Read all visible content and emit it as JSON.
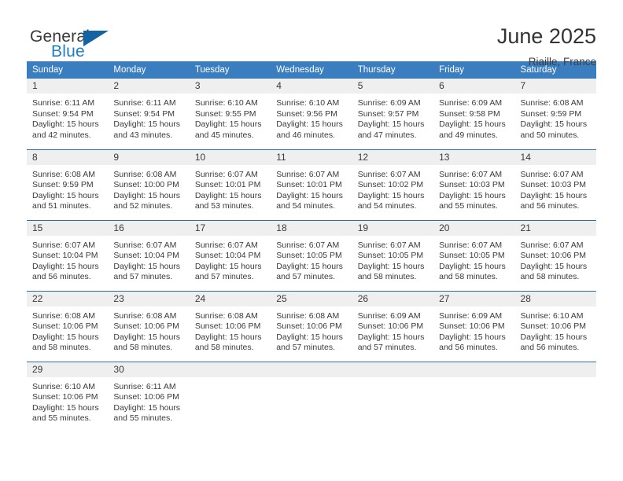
{
  "brand": {
    "word_one": "General",
    "word_two": "Blue",
    "logo_icon": "triangle-logo-icon"
  },
  "header": {
    "title": "June 2025",
    "location": "Riaille, France"
  },
  "calendar": {
    "weekday_headers": [
      "Sunday",
      "Monday",
      "Tuesday",
      "Wednesday",
      "Thursday",
      "Friday",
      "Saturday"
    ],
    "colors": {
      "header_blue": "#3a7ebf",
      "row_border_blue": "#2e6da4",
      "daynum_band": "#efefef",
      "brand_blue": "#1f7ec4",
      "logo_blue": "#1464a5"
    },
    "weeks": [
      [
        {
          "day": "1",
          "sunrise": "Sunrise: 6:11 AM",
          "sunset": "Sunset: 9:54 PM",
          "daylight_line1": "Daylight: 15 hours",
          "daylight_line2": "and 42 minutes."
        },
        {
          "day": "2",
          "sunrise": "Sunrise: 6:11 AM",
          "sunset": "Sunset: 9:54 PM",
          "daylight_line1": "Daylight: 15 hours",
          "daylight_line2": "and 43 minutes."
        },
        {
          "day": "3",
          "sunrise": "Sunrise: 6:10 AM",
          "sunset": "Sunset: 9:55 PM",
          "daylight_line1": "Daylight: 15 hours",
          "daylight_line2": "and 45 minutes."
        },
        {
          "day": "4",
          "sunrise": "Sunrise: 6:10 AM",
          "sunset": "Sunset: 9:56 PM",
          "daylight_line1": "Daylight: 15 hours",
          "daylight_line2": "and 46 minutes."
        },
        {
          "day": "5",
          "sunrise": "Sunrise: 6:09 AM",
          "sunset": "Sunset: 9:57 PM",
          "daylight_line1": "Daylight: 15 hours",
          "daylight_line2": "and 47 minutes."
        },
        {
          "day": "6",
          "sunrise": "Sunrise: 6:09 AM",
          "sunset": "Sunset: 9:58 PM",
          "daylight_line1": "Daylight: 15 hours",
          "daylight_line2": "and 49 minutes."
        },
        {
          "day": "7",
          "sunrise": "Sunrise: 6:08 AM",
          "sunset": "Sunset: 9:59 PM",
          "daylight_line1": "Daylight: 15 hours",
          "daylight_line2": "and 50 minutes."
        }
      ],
      [
        {
          "day": "8",
          "sunrise": "Sunrise: 6:08 AM",
          "sunset": "Sunset: 9:59 PM",
          "daylight_line1": "Daylight: 15 hours",
          "daylight_line2": "and 51 minutes."
        },
        {
          "day": "9",
          "sunrise": "Sunrise: 6:08 AM",
          "sunset": "Sunset: 10:00 PM",
          "daylight_line1": "Daylight: 15 hours",
          "daylight_line2": "and 52 minutes."
        },
        {
          "day": "10",
          "sunrise": "Sunrise: 6:07 AM",
          "sunset": "Sunset: 10:01 PM",
          "daylight_line1": "Daylight: 15 hours",
          "daylight_line2": "and 53 minutes."
        },
        {
          "day": "11",
          "sunrise": "Sunrise: 6:07 AM",
          "sunset": "Sunset: 10:01 PM",
          "daylight_line1": "Daylight: 15 hours",
          "daylight_line2": "and 54 minutes."
        },
        {
          "day": "12",
          "sunrise": "Sunrise: 6:07 AM",
          "sunset": "Sunset: 10:02 PM",
          "daylight_line1": "Daylight: 15 hours",
          "daylight_line2": "and 54 minutes."
        },
        {
          "day": "13",
          "sunrise": "Sunrise: 6:07 AM",
          "sunset": "Sunset: 10:03 PM",
          "daylight_line1": "Daylight: 15 hours",
          "daylight_line2": "and 55 minutes."
        },
        {
          "day": "14",
          "sunrise": "Sunrise: 6:07 AM",
          "sunset": "Sunset: 10:03 PM",
          "daylight_line1": "Daylight: 15 hours",
          "daylight_line2": "and 56 minutes."
        }
      ],
      [
        {
          "day": "15",
          "sunrise": "Sunrise: 6:07 AM",
          "sunset": "Sunset: 10:04 PM",
          "daylight_line1": "Daylight: 15 hours",
          "daylight_line2": "and 56 minutes."
        },
        {
          "day": "16",
          "sunrise": "Sunrise: 6:07 AM",
          "sunset": "Sunset: 10:04 PM",
          "daylight_line1": "Daylight: 15 hours",
          "daylight_line2": "and 57 minutes."
        },
        {
          "day": "17",
          "sunrise": "Sunrise: 6:07 AM",
          "sunset": "Sunset: 10:04 PM",
          "daylight_line1": "Daylight: 15 hours",
          "daylight_line2": "and 57 minutes."
        },
        {
          "day": "18",
          "sunrise": "Sunrise: 6:07 AM",
          "sunset": "Sunset: 10:05 PM",
          "daylight_line1": "Daylight: 15 hours",
          "daylight_line2": "and 57 minutes."
        },
        {
          "day": "19",
          "sunrise": "Sunrise: 6:07 AM",
          "sunset": "Sunset: 10:05 PM",
          "daylight_line1": "Daylight: 15 hours",
          "daylight_line2": "and 58 minutes."
        },
        {
          "day": "20",
          "sunrise": "Sunrise: 6:07 AM",
          "sunset": "Sunset: 10:05 PM",
          "daylight_line1": "Daylight: 15 hours",
          "daylight_line2": "and 58 minutes."
        },
        {
          "day": "21",
          "sunrise": "Sunrise: 6:07 AM",
          "sunset": "Sunset: 10:06 PM",
          "daylight_line1": "Daylight: 15 hours",
          "daylight_line2": "and 58 minutes."
        }
      ],
      [
        {
          "day": "22",
          "sunrise": "Sunrise: 6:08 AM",
          "sunset": "Sunset: 10:06 PM",
          "daylight_line1": "Daylight: 15 hours",
          "daylight_line2": "and 58 minutes."
        },
        {
          "day": "23",
          "sunrise": "Sunrise: 6:08 AM",
          "sunset": "Sunset: 10:06 PM",
          "daylight_line1": "Daylight: 15 hours",
          "daylight_line2": "and 58 minutes."
        },
        {
          "day": "24",
          "sunrise": "Sunrise: 6:08 AM",
          "sunset": "Sunset: 10:06 PM",
          "daylight_line1": "Daylight: 15 hours",
          "daylight_line2": "and 58 minutes."
        },
        {
          "day": "25",
          "sunrise": "Sunrise: 6:08 AM",
          "sunset": "Sunset: 10:06 PM",
          "daylight_line1": "Daylight: 15 hours",
          "daylight_line2": "and 57 minutes."
        },
        {
          "day": "26",
          "sunrise": "Sunrise: 6:09 AM",
          "sunset": "Sunset: 10:06 PM",
          "daylight_line1": "Daylight: 15 hours",
          "daylight_line2": "and 57 minutes."
        },
        {
          "day": "27",
          "sunrise": "Sunrise: 6:09 AM",
          "sunset": "Sunset: 10:06 PM",
          "daylight_line1": "Daylight: 15 hours",
          "daylight_line2": "and 56 minutes."
        },
        {
          "day": "28",
          "sunrise": "Sunrise: 6:10 AM",
          "sunset": "Sunset: 10:06 PM",
          "daylight_line1": "Daylight: 15 hours",
          "daylight_line2": "and 56 minutes."
        }
      ],
      [
        {
          "day": "29",
          "sunrise": "Sunrise: 6:10 AM",
          "sunset": "Sunset: 10:06 PM",
          "daylight_line1": "Daylight: 15 hours",
          "daylight_line2": "and 55 minutes."
        },
        {
          "day": "30",
          "sunrise": "Sunrise: 6:11 AM",
          "sunset": "Sunset: 10:06 PM",
          "daylight_line1": "Daylight: 15 hours",
          "daylight_line2": "and 55 minutes."
        },
        {
          "day": "",
          "sunrise": "",
          "sunset": "",
          "daylight_line1": "",
          "daylight_line2": ""
        },
        {
          "day": "",
          "sunrise": "",
          "sunset": "",
          "daylight_line1": "",
          "daylight_line2": ""
        },
        {
          "day": "",
          "sunrise": "",
          "sunset": "",
          "daylight_line1": "",
          "daylight_line2": ""
        },
        {
          "day": "",
          "sunrise": "",
          "sunset": "",
          "daylight_line1": "",
          "daylight_line2": ""
        },
        {
          "day": "",
          "sunrise": "",
          "sunset": "",
          "daylight_line1": "",
          "daylight_line2": ""
        }
      ]
    ]
  }
}
